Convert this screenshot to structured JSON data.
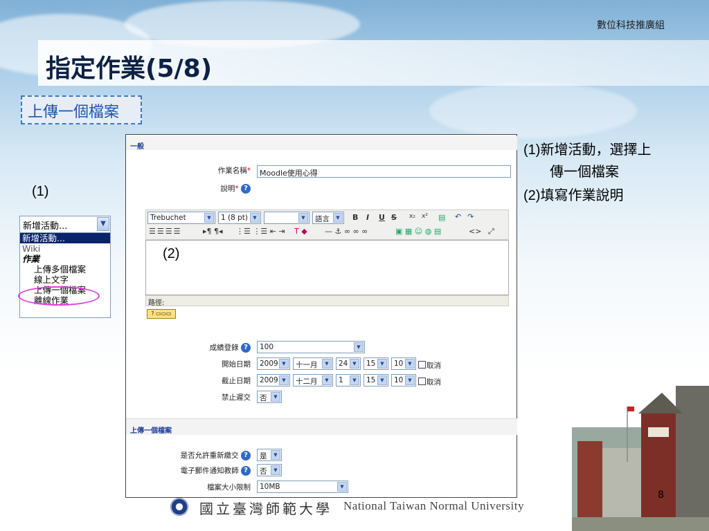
{
  "org": "數位科技推廣組",
  "title": "指定作業(5/8)",
  "subtitle": "上傳一個檔案",
  "notes": {
    "n1a": "(1)新增活動，選擇上",
    "n1b": "傳一個檔案",
    "n2": "(2)填寫作業說明"
  },
  "label1": "(1)",
  "dropdown": {
    "selected": "新增活動...",
    "arrow": "▼",
    "items": [
      "新增活動...",
      "Wiki",
      "作業",
      "上傳多個檔案",
      "線上文字",
      "上傳一個檔案",
      "離線作業"
    ]
  },
  "form": {
    "section_general": "一般",
    "name_label": "作業名稱",
    "name_value": "Moodle使用心得",
    "desc_label": "說明",
    "toolbar": {
      "font": "Trebuchet",
      "size": "1 (8 pt)",
      "lang": "語言",
      "bold": "B",
      "italic": "I",
      "underline": "U",
      "strike": "S",
      "sub": "x₂",
      "sup": "x²",
      "undo": "↶",
      "redo": "↷"
    },
    "editor_marker": "(2)",
    "path_label": "路徑:",
    "grade_label": "成績登錄",
    "grade_value": "100",
    "start_label": "開始日期",
    "start": {
      "y": "2009",
      "m": "十一月",
      "d": "24",
      "h": "15",
      "min": "10"
    },
    "end_label": "截止日期",
    "end": {
      "y": "2009",
      "m": "十二月",
      "d": "1",
      "h": "15",
      "min": "10"
    },
    "disable_label": "取消",
    "prevent_label": "禁止遲交",
    "prevent_value": "否",
    "section_upload": "上傳一個檔案",
    "resubmit_label": "是否允許重新繳交",
    "resubmit_value": "是",
    "email_label": "電子郵件通知教師",
    "email_value": "否",
    "maxsize_label": "檔案大小限制",
    "maxsize_value": "10MB"
  },
  "footer": {
    "univ_zh": "國立臺灣師範大學",
    "univ_en": "National Taiwan Normal University",
    "page": "8"
  }
}
